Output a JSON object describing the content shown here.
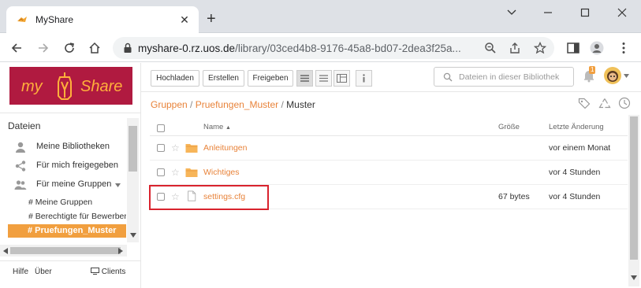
{
  "browser": {
    "tab_title": "MyShare",
    "url_host": "myshare-0.rz.uos.de",
    "url_path": "/library/03ced4b8-9176-45a8-bd07-2dea3f25a..."
  },
  "logo": {
    "left": "my",
    "right": "Share"
  },
  "sidebar": {
    "heading": "Dateien",
    "items": [
      {
        "label": "Meine Bibliotheken",
        "icon": "user-icon"
      },
      {
        "label": "Für mich freigegeben",
        "icon": "share-icon"
      },
      {
        "label": "Für meine Gruppen",
        "icon": "group-icon"
      }
    ],
    "subitems": [
      {
        "label": "# Meine Gruppen"
      },
      {
        "label": "# Berechtigte für Bewerber"
      }
    ],
    "active": "# Pruefungen_Muster",
    "footer": {
      "help": "Hilfe",
      "about": "Über",
      "clients": "Clients"
    }
  },
  "toolbar": {
    "upload": "Hochladen",
    "create": "Erstellen",
    "share": "Freigeben",
    "search_placeholder": "Dateien in dieser Bibliothek"
  },
  "notification_count": "1",
  "breadcrumb": {
    "groups": "Gruppen",
    "library": "Pruefungen_Muster",
    "current": "Muster",
    "sep": "/"
  },
  "table": {
    "col_name": "Name",
    "col_size": "Größe",
    "col_modified": "Letzte Änderung",
    "rows": [
      {
        "name": "Anleitungen",
        "type": "folder",
        "size": "",
        "modified": "vor einem Monat"
      },
      {
        "name": "Wichtiges",
        "type": "folder",
        "size": "",
        "modified": "vor 4 Stunden"
      },
      {
        "name": "settings.cfg",
        "type": "file",
        "size": "67 bytes",
        "modified": "vor 4 Stunden"
      }
    ]
  },
  "colors": {
    "accent": "#e8833a",
    "brand": "#b01a40",
    "highlight": "#d9232e"
  }
}
